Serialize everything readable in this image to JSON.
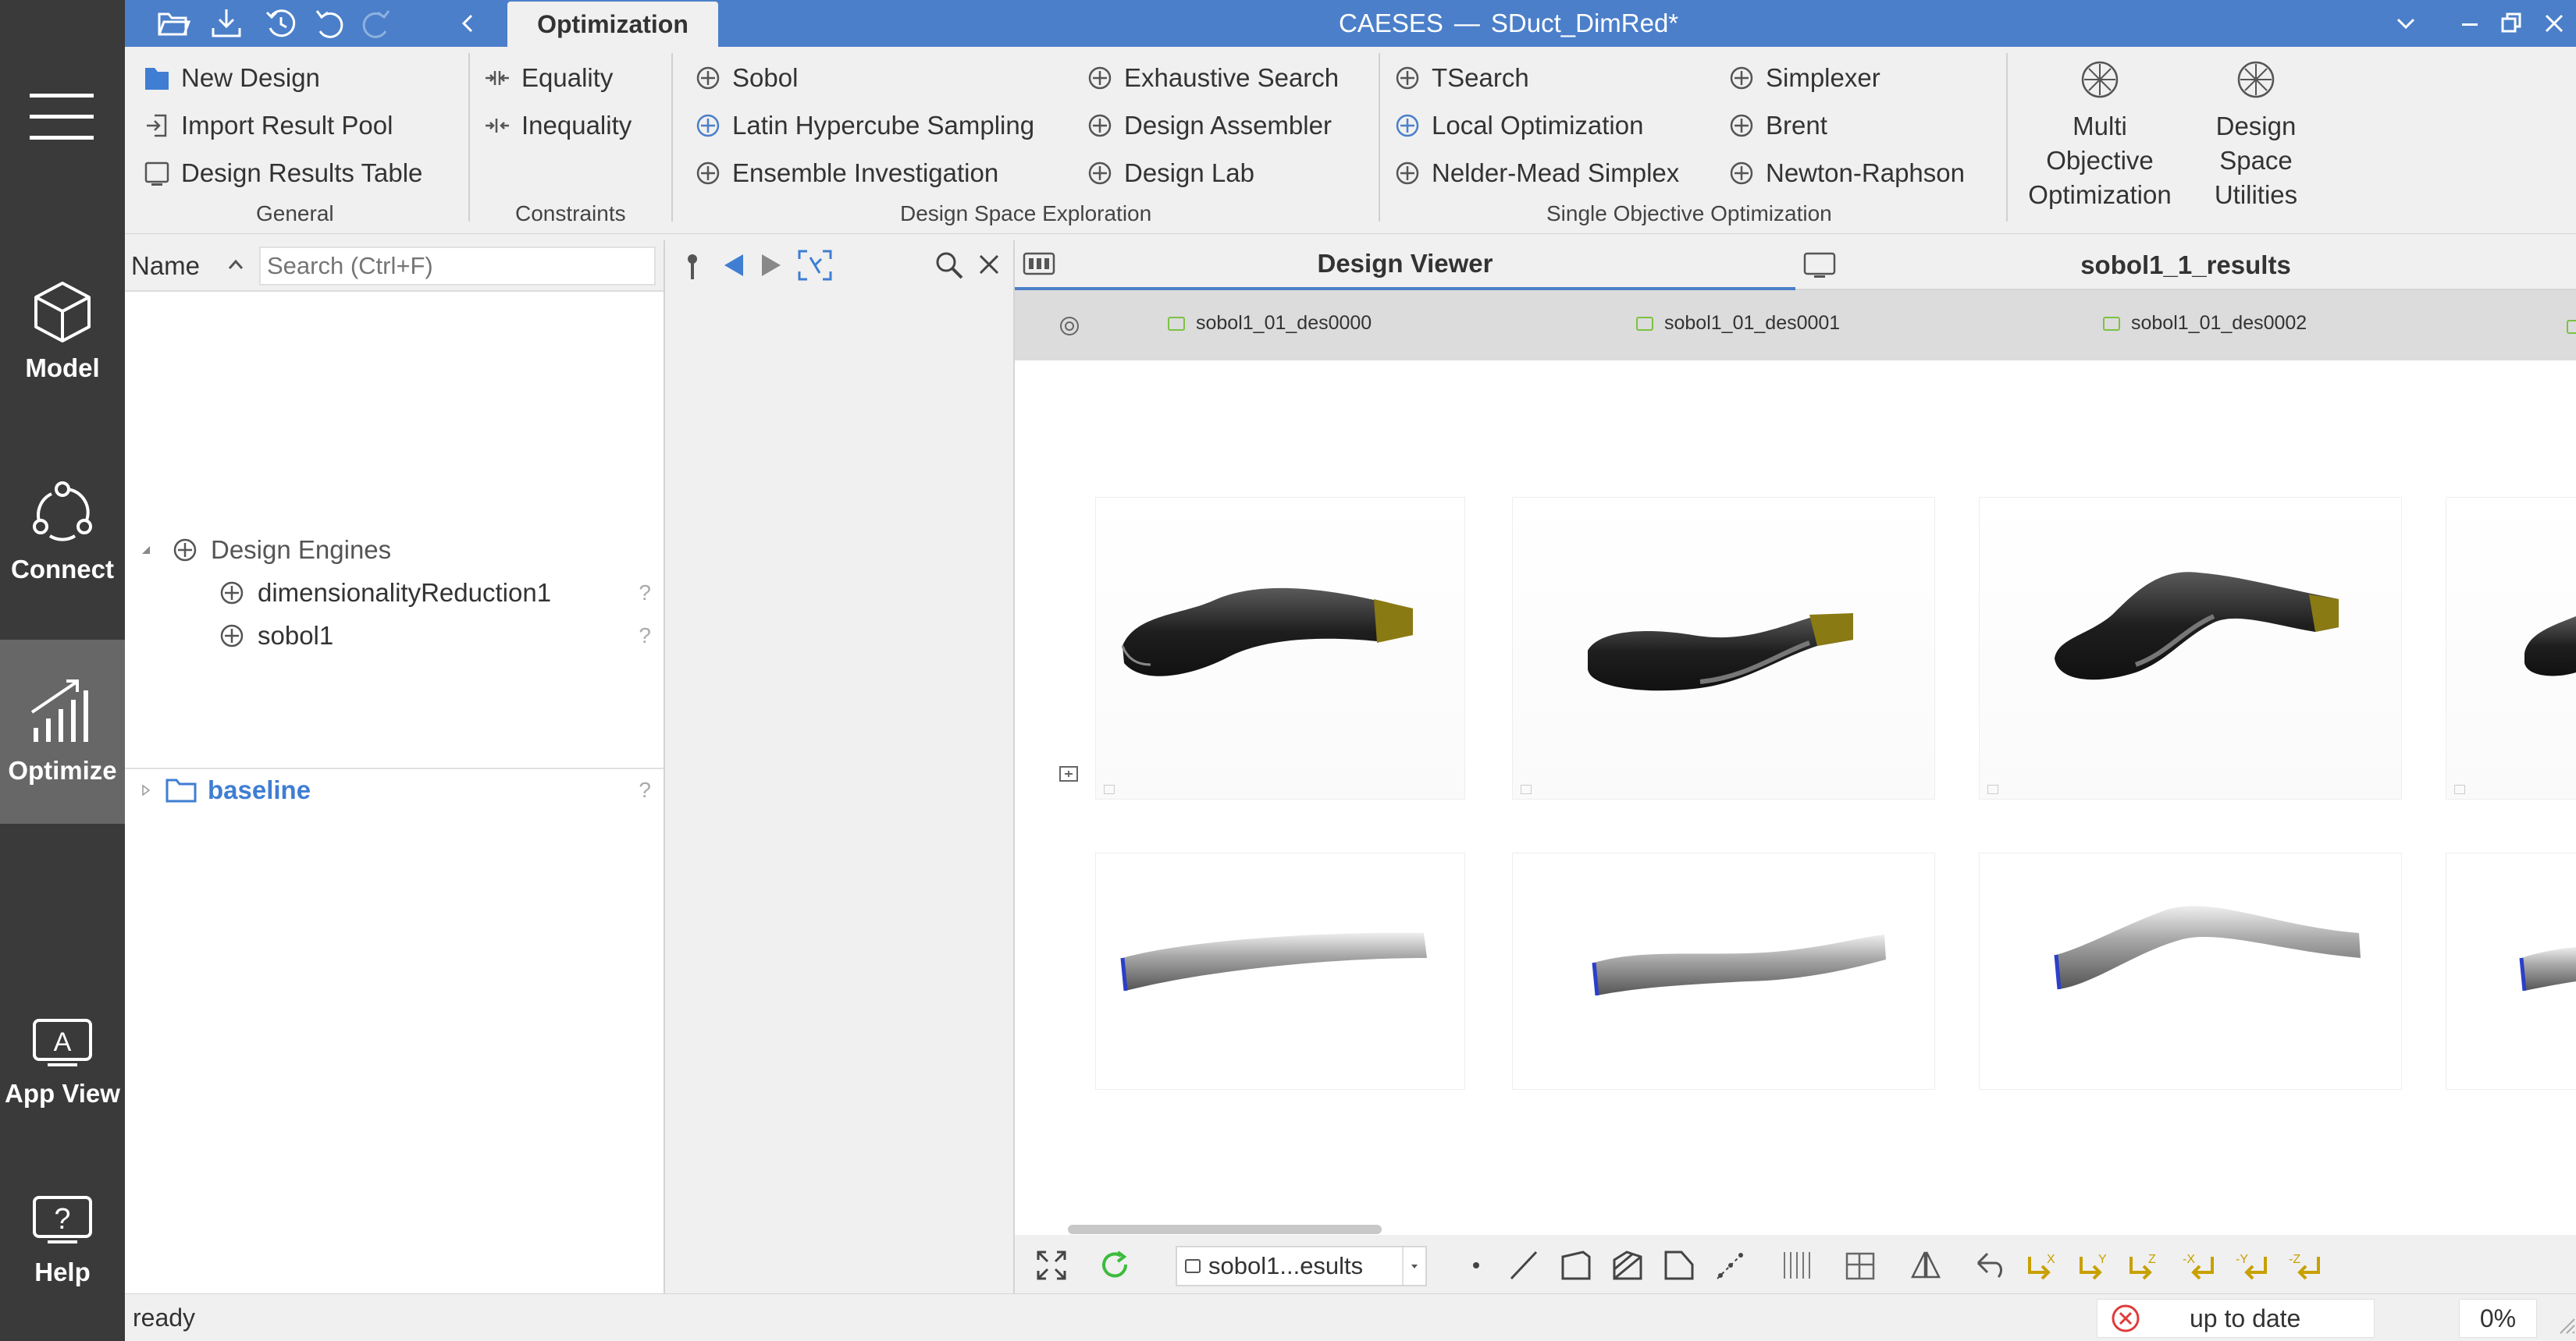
{
  "app": {
    "title": "CAESES",
    "title_sep": "—",
    "document": "SDuct_DimRed*"
  },
  "active_tab": "Optimization",
  "left_nav": [
    {
      "label": "Model",
      "icon": "cube-icon"
    },
    {
      "label": "Connect",
      "icon": "connect-icon"
    },
    {
      "label": "Optimize",
      "icon": "optimize-chart-icon",
      "active": true
    },
    {
      "label": "App View",
      "icon": "app-view-icon"
    },
    {
      "label": "Help",
      "icon": "help-icon"
    }
  ],
  "ribbon": {
    "general": {
      "label": "General",
      "items": [
        "New Design",
        "Import Result Pool",
        "Design Results Table"
      ]
    },
    "constraints": {
      "label": "Constraints",
      "items": [
        "Equality",
        "Inequality"
      ]
    },
    "dse": {
      "label": "Design Space Exploration",
      "items": [
        "Sobol",
        "Latin Hypercube Sampling",
        "Ensemble Investigation",
        "Exhaustive Search",
        "Design Assembler",
        "Design Lab"
      ]
    },
    "soo": {
      "label": "Single Objective Optimization",
      "items": [
        "TSearch",
        "Local Optimization",
        "Nelder-Mead Simplex",
        "Simplexer",
        "Brent",
        "Newton-Raphson"
      ]
    },
    "moo": {
      "line1": "Multi",
      "line2": "Objective",
      "line3": "Optimization"
    },
    "dsu": {
      "line1": "Design",
      "line2": "Space",
      "line3": "Utilities"
    }
  },
  "tree": {
    "name_header": "Name",
    "search_placeholder": "Search (Ctrl+F)",
    "root": "Design Engines",
    "children": [
      "dimensionalityReduction1",
      "sobol1"
    ],
    "help_mark": "?",
    "baseline": "baseline"
  },
  "viewer": {
    "tab1": "Design Viewer",
    "tab2": "sobol1_1_results",
    "columns": [
      "sobol1_01_des0000",
      "sobol1_01_des0001",
      "sobol1_01_des0002"
    ],
    "dataset": "sobol1...esults"
  },
  "status": {
    "text": "ready",
    "sync": "up to date",
    "progress": "0%"
  },
  "colors": {
    "accent": "#4b7fc9",
    "nav_bg": "#3a3a3a",
    "nav_active": "#676767"
  }
}
